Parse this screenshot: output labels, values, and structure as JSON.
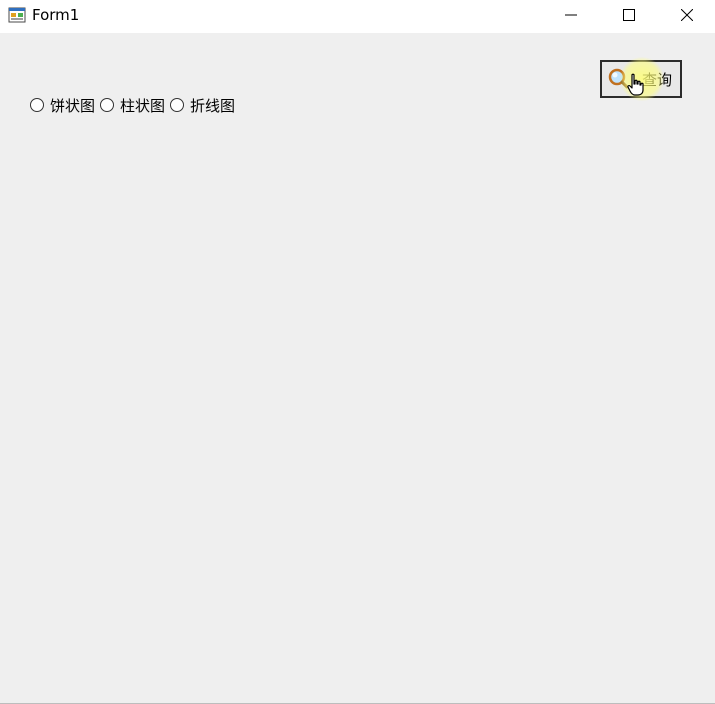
{
  "window": {
    "title": "Form1"
  },
  "titlebar": {
    "icons": {
      "app": "winforms-app-icon",
      "minimize": "minimize-icon",
      "maximize": "maximize-icon",
      "close": "close-icon"
    }
  },
  "chart_type_options": [
    {
      "label": "饼状图",
      "selected": false
    },
    {
      "label": "柱状图",
      "selected": false
    },
    {
      "label": "折线图",
      "selected": false
    }
  ],
  "query_button": {
    "label": "查询",
    "icon": "magnifier-icon"
  },
  "colors": {
    "client_background": "#efefef",
    "titlebar_background": "#ffffff",
    "cursor_highlight": "#ffff78"
  }
}
